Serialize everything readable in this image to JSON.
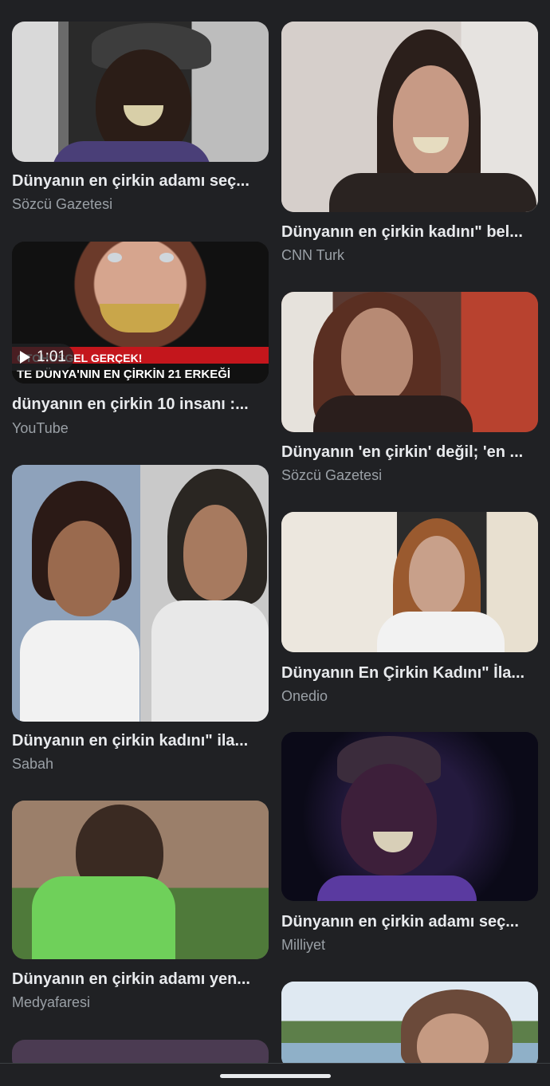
{
  "results": {
    "left": [
      {
        "title": "Dünyanın en çirkin adamı seç...",
        "source": "Sözcü Gazetesi"
      },
      {
        "title": "dünyanın en çirkin 10 insanı :...",
        "source": "YouTube",
        "duration": "1:01",
        "overlay_top": "OTOHOSGEL GERÇEK!",
        "overlay_bottom": "TE DÜNYA'NIN EN ÇİRKİN 21 ERKEĞİ"
      },
      {
        "title": "Dünyanın en çirkin kadını\" ila...",
        "source": "Sabah"
      },
      {
        "title": "Dünyanın en çirkin adamı yen...",
        "source": "Medyafaresi"
      }
    ],
    "right": [
      {
        "title": "Dünyanın en çirkin kadını\" bel...",
        "source": "CNN Turk"
      },
      {
        "title": "Dünyanın 'en çirkin' değil; 'en ...",
        "source": "Sözcü Gazetesi"
      },
      {
        "title": "Dünyanın En Çirkin Kadını\" İla...",
        "source": "Onedio"
      },
      {
        "title": "Dünyanın en çirkin adamı seç...",
        "source": "Milliyet"
      }
    ]
  }
}
